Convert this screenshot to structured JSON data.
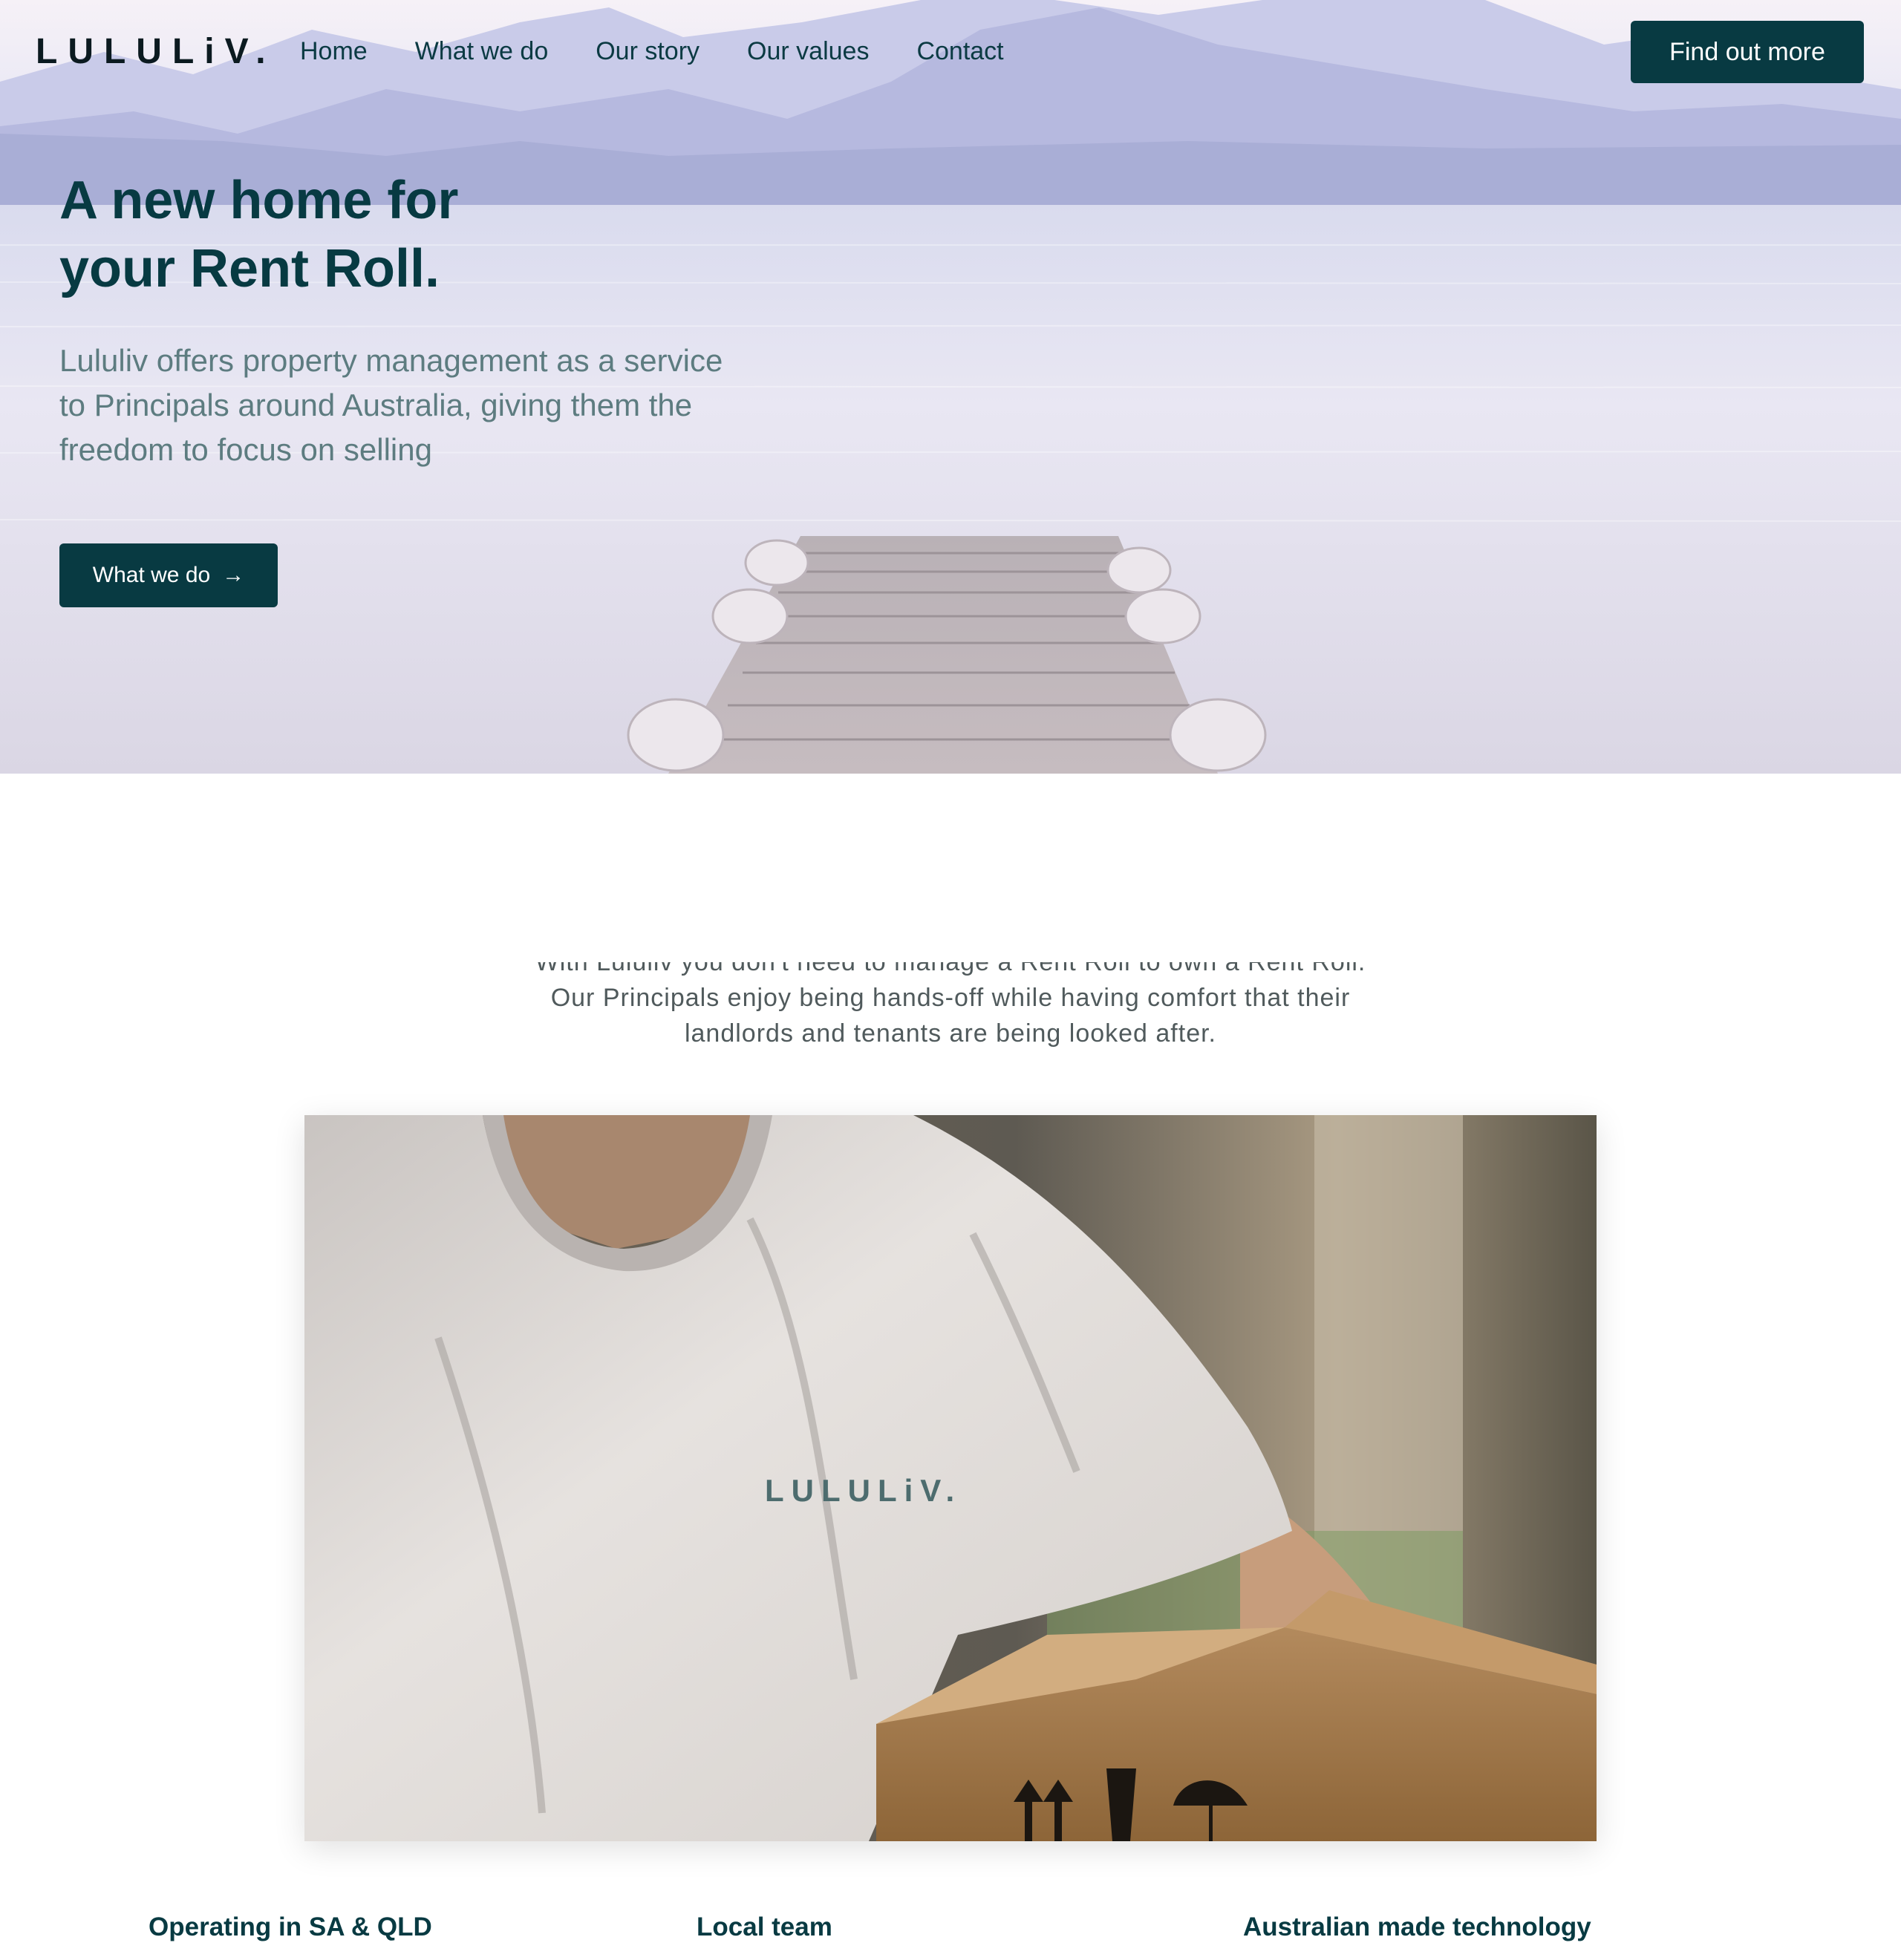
{
  "brand": {
    "logo": "LULULiV."
  },
  "nav": {
    "links": [
      "Home",
      "What we do",
      "Our story",
      "Our values",
      "Contact"
    ],
    "cta": "Find out more"
  },
  "hero": {
    "title_line1": "A new home for",
    "title_line2": "your Rent Roll.",
    "subtitle": "Lululiv offers property management as a service to Principals around Australia, giving them the freedom to focus on selling",
    "button_label": "What we do",
    "button_arrow": "→"
  },
  "intro": {
    "line1": "With Lululiv you don't need to manage a Rent Roll to own a Rent Roll.",
    "line2": "Our Principals enjoy being hands-off while having comfort that their",
    "line3": "landlords and tenants are being looked after."
  },
  "photo": {
    "shirt_print": "LULULiV."
  },
  "features": [
    "Operating in SA & QLD",
    "Local team",
    "Australian made technology"
  ],
  "colors": {
    "brand_dark": "#083a42",
    "hero_text": "#073a42",
    "muted": "#5d7c80"
  }
}
